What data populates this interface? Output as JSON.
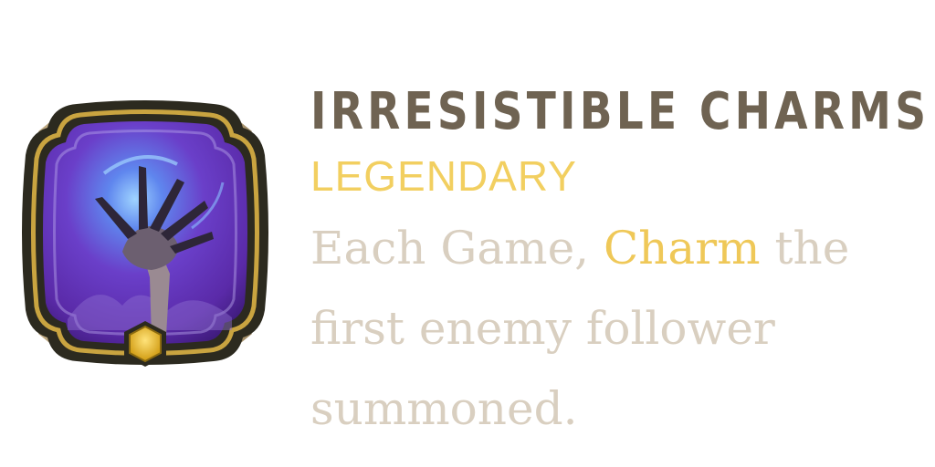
{
  "card": {
    "title": "IRRESISTIBLE CHARMS",
    "rarity": "LEGENDARY",
    "description": {
      "before": "Each Game, ",
      "keyword": "Charm",
      "after_line1": " the",
      "line2": "first enemy follower",
      "line3": "summoned."
    },
    "icon": "clawed-hand-icon",
    "gem_icon": "hexagon-gem-icon"
  },
  "colors": {
    "title": "#6f6352",
    "rarity": "#f2cf60",
    "description": "#d9cfc0",
    "keyword": "#efc858",
    "frame_gold": "#c9a440",
    "frame_dark": "#2c2a1f",
    "art_purple": "#6a3fc9"
  }
}
